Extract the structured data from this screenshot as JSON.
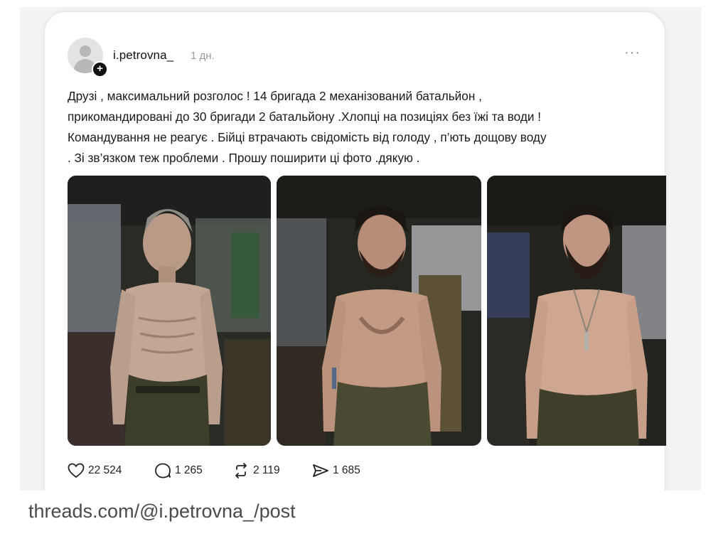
{
  "post": {
    "username": "i.petrovna_",
    "time": "1 дн.",
    "more": "···",
    "follow_badge": "+",
    "text_lines": [
      "Друзі , максимальний розголос ! 14 бригада 2 механізований батальйон ,",
      "прикомандировані до 30 бригади 2 батальйону .Хлопці на позиціях без їжі та води !",
      "Командування не реагує . Бійці втрачають свідомість від голоду , п’ють дощову воду",
      ". Зі зв’язком теж проблеми . Прошу поширити ці фото .дякую ."
    ],
    "photos": [
      {
        "icon": "photo-soldier-1"
      },
      {
        "icon": "photo-soldier-2"
      },
      {
        "icon": "photo-soldier-3"
      }
    ],
    "stats": {
      "likes": "22 524",
      "replies": "1 265",
      "reposts": "2 119",
      "shares": "1 685"
    },
    "icons": {
      "like": "heart-icon",
      "reply": "comment-icon",
      "repost": "repost-icon",
      "share": "send-icon"
    }
  },
  "caption": "threads.com/@i.petrovna_/post",
  "colors": {
    "card_border": "#e4e4e4",
    "text": "#1a1a1a",
    "muted": "#9a9a9a",
    "caption": "#4a4a4a",
    "frame": "#f3f3f3"
  }
}
